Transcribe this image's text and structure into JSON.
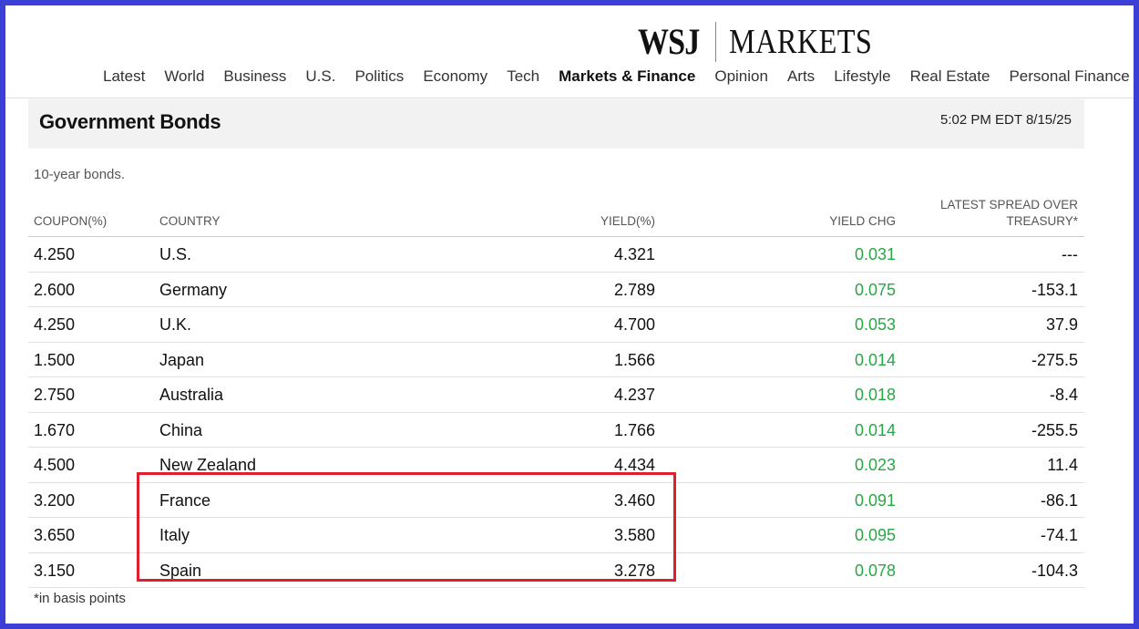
{
  "masthead": {
    "wsj": "WSJ",
    "markets": "MARKETS"
  },
  "nav": [
    "Latest",
    "World",
    "Business",
    "U.S.",
    "Politics",
    "Economy",
    "Tech",
    "Markets & Finance",
    "Opinion",
    "Arts",
    "Lifestyle",
    "Real Estate",
    "Personal Finance"
  ],
  "nav_active": "Markets & Finance",
  "panel": {
    "title": "Government Bonds",
    "timestamp": "5:02 PM EDT 8/15/25",
    "subtitle": "10-year bonds."
  },
  "columns": {
    "coupon": "COUPON(%)",
    "country": "COUNTRY",
    "yield": "YIELD(%)",
    "yield_chg": "YIELD CHG",
    "spread_line1": "LATEST SPREAD OVER",
    "spread_line2": "TREASURY*"
  },
  "rows": [
    {
      "coupon": "4.250",
      "country": "U.S.",
      "yield": "4.321",
      "chg": "0.031",
      "spread": "---"
    },
    {
      "coupon": "2.600",
      "country": "Germany",
      "yield": "2.789",
      "chg": "0.075",
      "spread": "-153.1"
    },
    {
      "coupon": "4.250",
      "country": "U.K.",
      "yield": "4.700",
      "chg": "0.053",
      "spread": "37.9"
    },
    {
      "coupon": "1.500",
      "country": "Japan",
      "yield": "1.566",
      "chg": "0.014",
      "spread": "-275.5"
    },
    {
      "coupon": "2.750",
      "country": "Australia",
      "yield": "4.237",
      "chg": "0.018",
      "spread": "-8.4"
    },
    {
      "coupon": "1.670",
      "country": "China",
      "yield": "1.766",
      "chg": "0.014",
      "spread": "-255.5"
    },
    {
      "coupon": "4.500",
      "country": "New Zealand",
      "yield": "4.434",
      "chg": "0.023",
      "spread": "11.4"
    },
    {
      "coupon": "3.200",
      "country": "France",
      "yield": "3.460",
      "chg": "0.091",
      "spread": "-86.1"
    },
    {
      "coupon": "3.650",
      "country": "Italy",
      "yield": "3.580",
      "chg": "0.095",
      "spread": "-74.1"
    },
    {
      "coupon": "3.150",
      "country": "Spain",
      "yield": "3.278",
      "chg": "0.078",
      "spread": "-104.3"
    }
  ],
  "footnote": "*in basis points",
  "colors": {
    "frame": "#3b3fd6",
    "highlight": "#e01e2d",
    "positive": "#27a844"
  }
}
